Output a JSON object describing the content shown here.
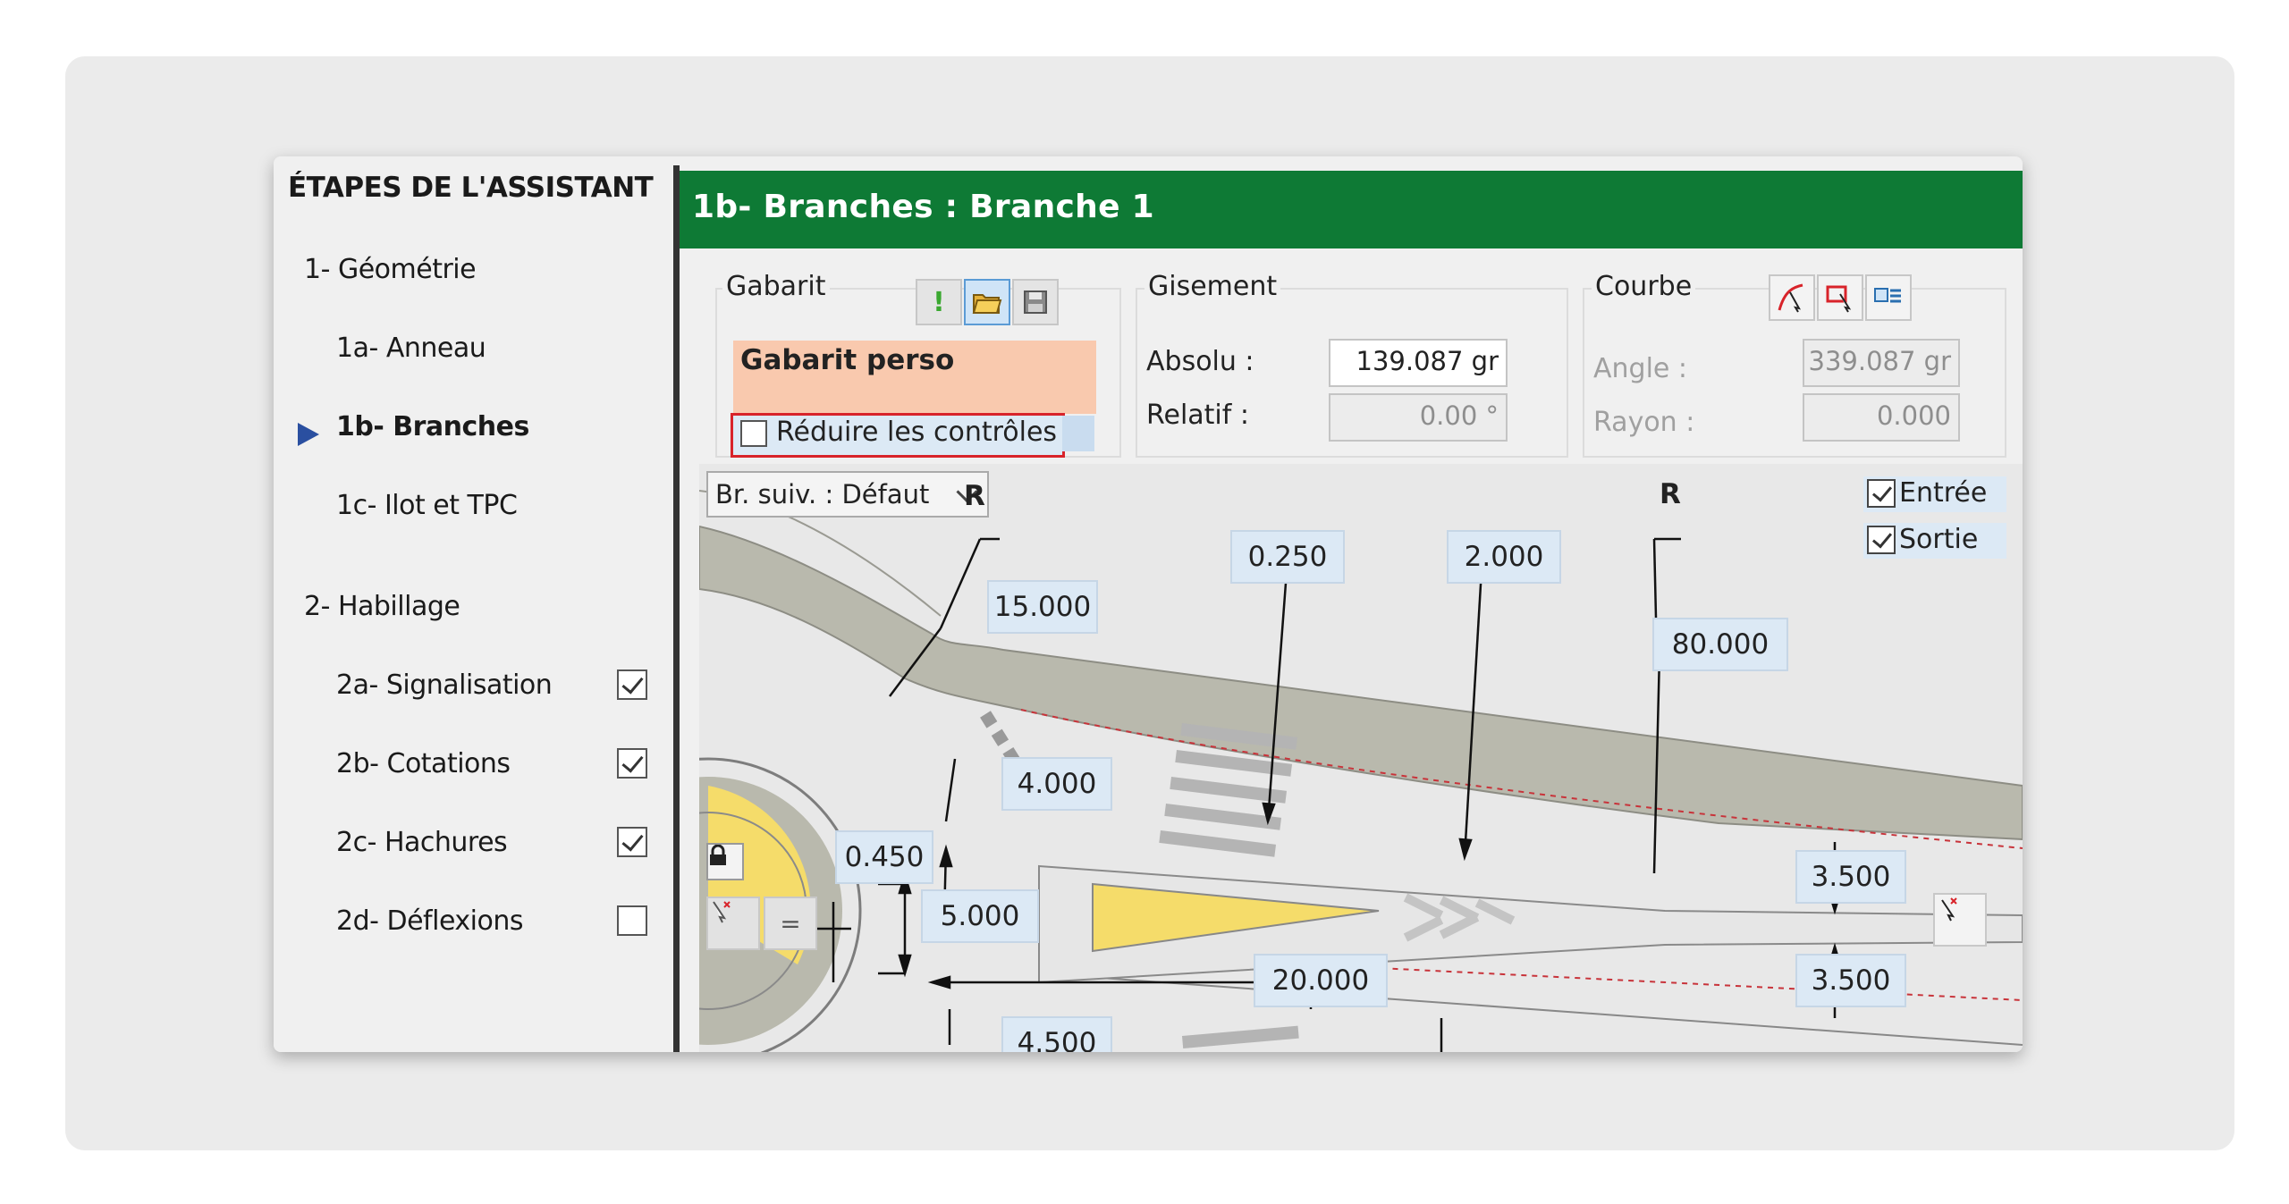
{
  "sidebar": {
    "title": "ÉTAPES DE L'ASSISTANT",
    "items": [
      {
        "label": "1- Géométrie"
      },
      {
        "label": "1a- Anneau"
      },
      {
        "label": "1b- Branches",
        "active": true
      },
      {
        "label": "1c- Ilot et TPC"
      },
      {
        "label": "2- Habillage"
      },
      {
        "label": "2a- Signalisation",
        "checked": true
      },
      {
        "label": "2b- Cotations",
        "checked": true
      },
      {
        "label": "2c- Hachures",
        "checked": true
      },
      {
        "label": "2d- Déflexions",
        "checked": false
      }
    ]
  },
  "header": {
    "title": "1b- Branches : Branche 1"
  },
  "gabarit": {
    "label": "Gabarit",
    "value": "Gabarit perso",
    "reduce_label": "Réduire les contrôles",
    "reduce_checked": false,
    "icons": [
      "exclamation-icon",
      "open-folder-icon",
      "save-icon"
    ]
  },
  "gisement": {
    "label": "Gisement",
    "absolu_label": "Absolu :",
    "absolu_value": "139.087 gr",
    "relatif_label": "Relatif :",
    "relatif_value": "0.00 °"
  },
  "courbe": {
    "label": "Courbe",
    "angle_label": "Angle :",
    "angle_value": "339.087 gr",
    "rayon_label": "Rayon :",
    "rayon_value": "0.000",
    "icons": [
      "curve-pick-icon",
      "select-rect-icon",
      "select-list-icon"
    ]
  },
  "canvas": {
    "dropdown": "Br. suiv. : Défaut",
    "entree_label": "Entrée",
    "sortie_label": "Sortie",
    "r_label": "R",
    "dims": {
      "d15": "15.000",
      "d0250": "0.250",
      "d2": "2.000",
      "d80": "80.000",
      "d4": "4.000",
      "d0450": "0.450",
      "d5": "5.000",
      "d20": "20.000",
      "d4500": "4.500",
      "d35a": "3.500",
      "d35b": "3.500"
    },
    "colors": {
      "road": "#b9b9ad",
      "island": "#f5dc6a",
      "green": "#0e7a35"
    }
  }
}
